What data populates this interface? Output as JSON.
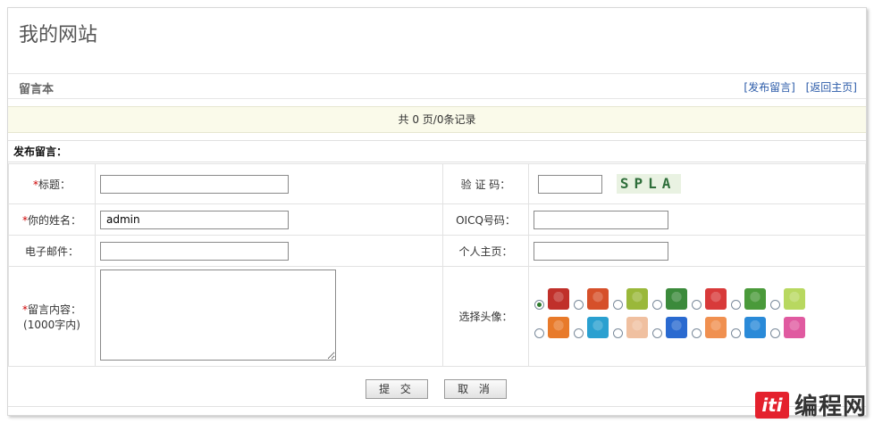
{
  "site": {
    "title": "我的网站"
  },
  "subbar": {
    "name": "留言本",
    "post_link": "[发布留言]",
    "home_link": "[返回主页]"
  },
  "pager": {
    "text": "共 0 页/0条记录"
  },
  "form": {
    "heading": "发布留言：",
    "required_mark": "*",
    "title_label": "标题：",
    "captcha_label": "验 证 码：",
    "captcha_text": "SPLA",
    "name_label": "你的姓名：",
    "name_value": "admin",
    "oicq_label": "OICQ号码：",
    "email_label": "电子邮件：",
    "homepage_label": "个人主页：",
    "content_label": "留言内容：",
    "content_limit": "(1000字内)",
    "avatar_label": "选择头像："
  },
  "avatars": {
    "selected_index": 0,
    "colors": [
      "#c0302a",
      "#d6502a",
      "#9ab83a",
      "#3b8a3b",
      "#d83a3a",
      "#4a9a3a",
      "#b8d860",
      "#e87a2a",
      "#2aa0d0",
      "#f0c0a0",
      "#2a6ad0",
      "#f09050",
      "#2a8ad8",
      "#e05aa0"
    ]
  },
  "buttons": {
    "submit": "提 交",
    "cancel": "取 消"
  },
  "watermark": {
    "logo": "iti",
    "text": "编程网"
  }
}
